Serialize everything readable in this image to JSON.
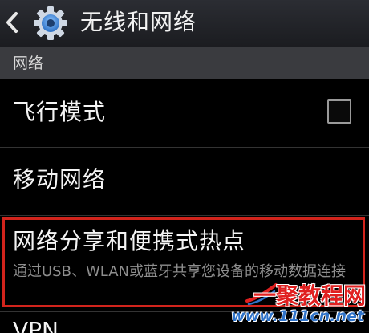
{
  "header": {
    "title": "无线和网络",
    "back_icon": "chevron-left-icon",
    "app_icon": "gear-icon"
  },
  "section": {
    "label": "网络"
  },
  "items": [
    {
      "label": "飞行模式",
      "checkbox": false
    },
    {
      "label": "移动网络"
    },
    {
      "label": "网络分享和便携式热点",
      "subtitle": "通过USB、WLAN或蓝牙共享您设备的移动数据连接"
    },
    {
      "label": "VPN"
    }
  ],
  "watermark": {
    "brand": "一聚教程网",
    "url": "www.111cn.net"
  },
  "colors": {
    "highlight": "#d2241c",
    "watermark_red": "#e02020",
    "watermark_blue": "#2f73c9"
  }
}
